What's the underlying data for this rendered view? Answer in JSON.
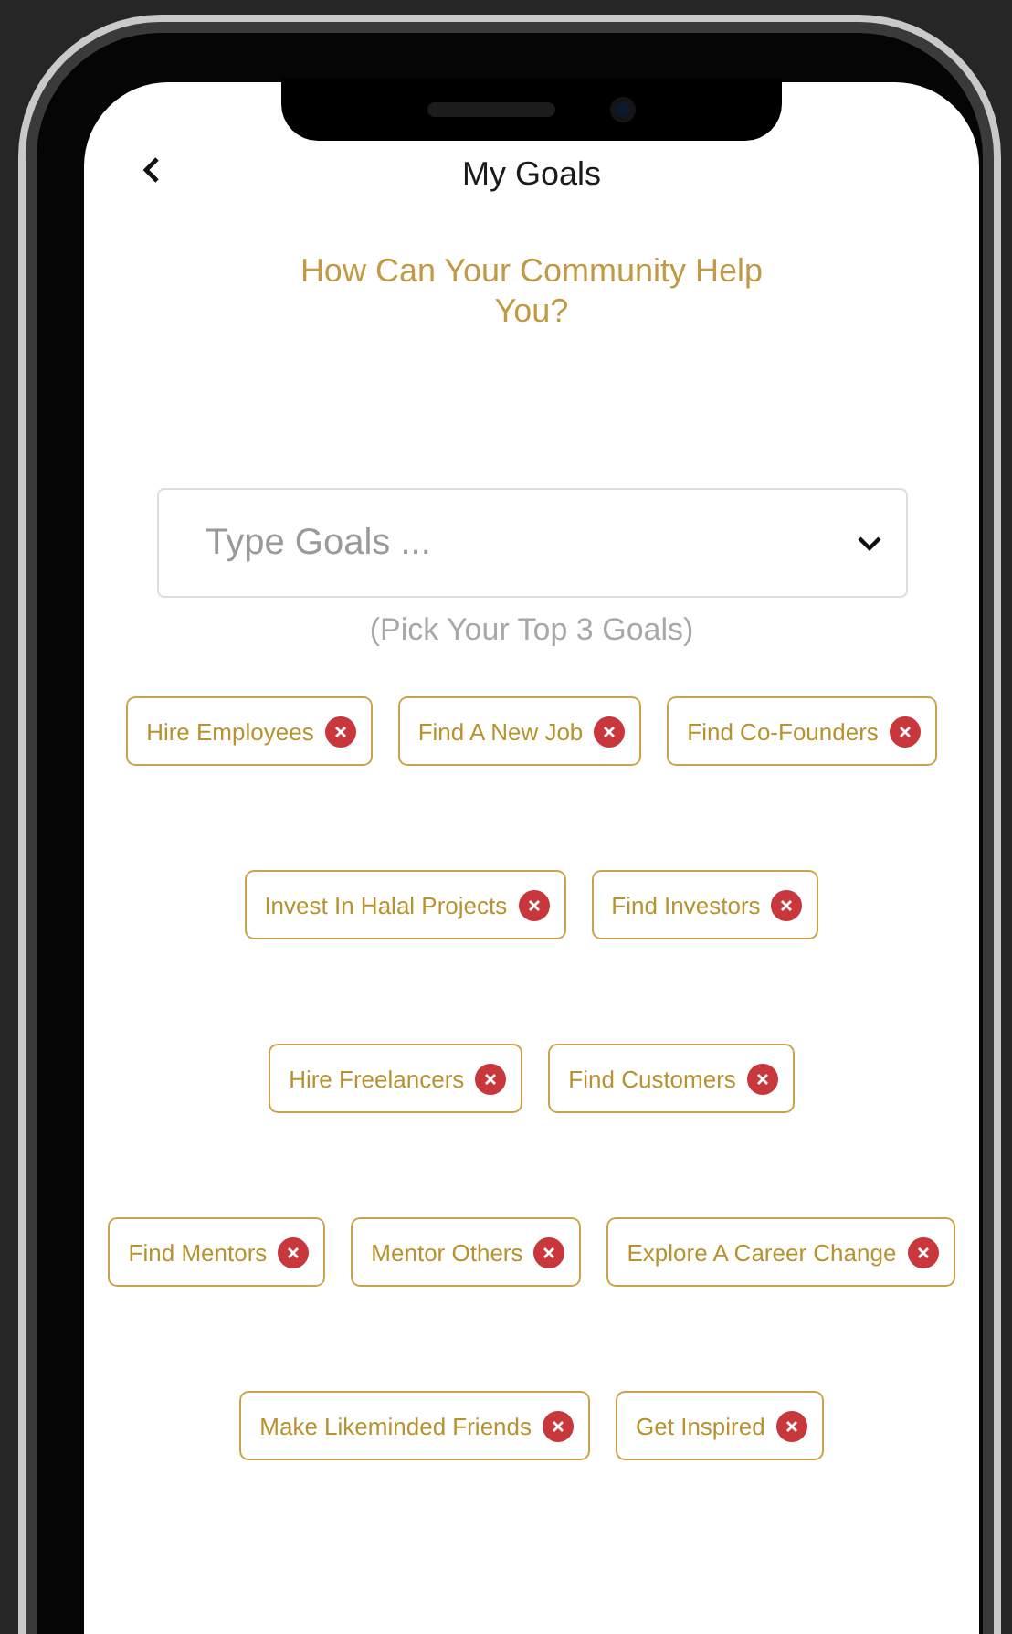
{
  "header": {
    "title": "My Goals"
  },
  "prompt": "How Can Your Community Help You?",
  "goal_field": {
    "placeholder": "Type Goals ..."
  },
  "hint": "(Pick Your Top 3 Goals)",
  "goal_rows": [
    {
      "chips": [
        {
          "label": "Hire Employees"
        },
        {
          "label": "Find A New Job"
        },
        {
          "label": "Find Co-Founders"
        }
      ]
    },
    {
      "chips": [
        {
          "label": "Invest In Halal Projects"
        },
        {
          "label": "Find Investors"
        }
      ]
    },
    {
      "chips": [
        {
          "label": "Hire Freelancers"
        },
        {
          "label": "Find Customers"
        }
      ]
    },
    {
      "chips": [
        {
          "label": "Find Mentors"
        },
        {
          "label": "Mentor Others"
        },
        {
          "label": "Explore A Career Change"
        }
      ]
    },
    {
      "chips": [
        {
          "label": "Make Likeminded Friends"
        },
        {
          "label": "Get Inspired"
        }
      ]
    }
  ]
}
